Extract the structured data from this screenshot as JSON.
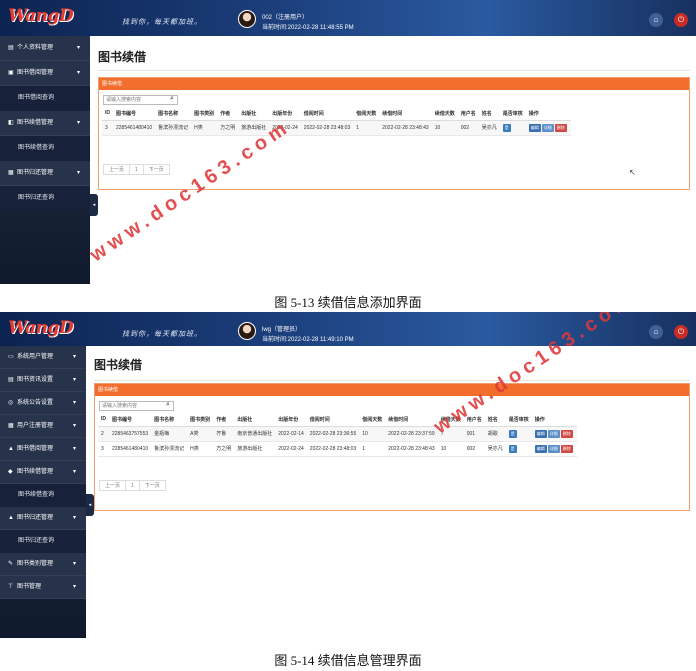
{
  "app": {
    "logo": "WangD",
    "slogan": "找到你，每天都加班。",
    "page_title": "图书续借",
    "panel_title": "图书续借",
    "search_placeholder": "请输入搜索内容",
    "icons": {
      "home": "home-icon",
      "power": "power-icon",
      "search": "search-icon"
    },
    "colors": {
      "header": "#1c3f7c",
      "accent": "#f36d2d",
      "sidebar": "#1a2538",
      "logo": "#e53b30",
      "delete": "#d04844"
    }
  },
  "columns": [
    "ID",
    "图书编号",
    "图书名称",
    "图书类别",
    "作者",
    "出版社",
    "出版年份",
    "借阅时间",
    "借阅天数",
    "续借时间",
    "续借天数",
    "用户名",
    "姓名",
    "是否审核",
    "操作"
  ],
  "actions": {
    "audit": "是",
    "edit": "编辑",
    "detail": "详细",
    "delete": "删除"
  },
  "pager": {
    "prev": "上一页",
    "page": "1",
    "next": "下一页"
  },
  "screen1": {
    "user": "002（注册用户）",
    "time": "当前时间:2022-02-28 11:48:55 PM",
    "menu": [
      {
        "label": "个人资料管理",
        "icon": "▤",
        "sub": []
      },
      {
        "label": "图书借阅管理",
        "icon": "▣",
        "sub": [
          "图书借阅查询"
        ]
      },
      {
        "label": "图书续借管理",
        "icon": "◧",
        "sub": [
          "图书续借查询"
        ]
      },
      {
        "label": "图书归还管理",
        "icon": "▦",
        "sub": [
          "图书归还查询"
        ]
      }
    ],
    "rows": [
      [
        "3",
        "2285461480410",
        "鲁滨孙漂流记",
        "H类",
        "方之明",
        "旅游出版社",
        "2022-02-24",
        "2022-02-28 23:48:03",
        "1",
        "2022-02-28 23:48:43",
        "10",
        "002",
        "吴亦凡"
      ]
    ],
    "caption": "图 5-13    续借信息添加界面"
  },
  "screen2": {
    "user": "lwg（管理员）",
    "time": "当前时间:2022-02-28 11:49:10 PM",
    "menu": [
      {
        "label": "系统用户管理",
        "icon": "▭",
        "sub": []
      },
      {
        "label": "图书资讯设置",
        "icon": "▤",
        "sub": []
      },
      {
        "label": "系统公告设置",
        "icon": "◎",
        "sub": []
      },
      {
        "label": "用户注册管理",
        "icon": "▦",
        "sub": []
      },
      {
        "label": "图书借阅管理",
        "icon": "▲",
        "sub": []
      },
      {
        "label": "图书续借管理",
        "icon": "◆",
        "sub": [
          "图书续借查询"
        ]
      },
      {
        "label": "图书归还管理",
        "icon": "▲",
        "sub": [
          "图书归还查询"
        ]
      },
      {
        "label": "图书类别管理",
        "icon": "✎",
        "sub": []
      },
      {
        "label": "图书管理",
        "icon": "⊤",
        "sub": []
      }
    ],
    "rows": [
      [
        "2",
        "2285463757553",
        "金瓶梅",
        "A类",
        "齐鲁",
        "南京普通出版社",
        "2022-02-14",
        "2022-02-28 23:36:55",
        "10",
        "2022-02-28 23:37:59",
        "7",
        "001",
        "胡歌"
      ],
      [
        "3",
        "2285461480410",
        "鲁滨孙漂流记",
        "H类",
        "方之明",
        "旅游出版社",
        "2022-02-24",
        "2022-02-28 23:48:03",
        "1",
        "2022-02-28 23:48:43",
        "10",
        "002",
        "吴亦凡"
      ]
    ],
    "caption": "图 5-14    续借信息管理界面"
  },
  "watermark": "www.doc163.com"
}
